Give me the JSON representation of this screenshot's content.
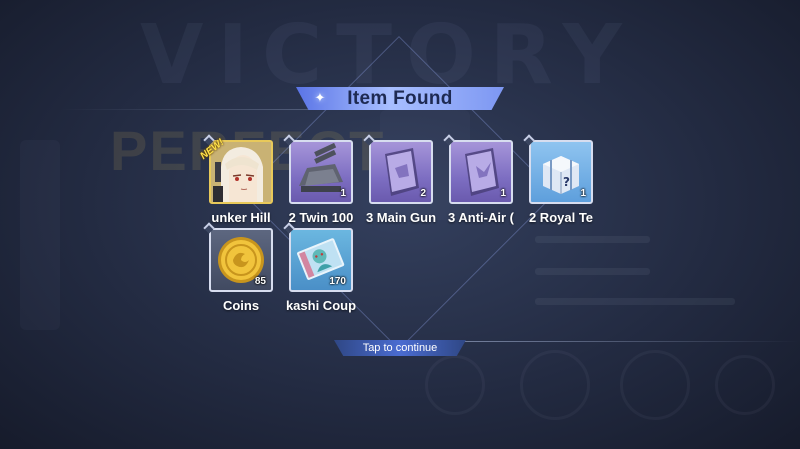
{
  "background": {
    "victory_text": "VICTORY",
    "rank_text": "PERFECT"
  },
  "header": {
    "title": "Item Found"
  },
  "items": [
    {
      "label": "unker Hill",
      "quantity": "",
      "new_badge": "NEW!",
      "icon": "character-portrait-icon"
    },
    {
      "label": "2 Twin 100",
      "quantity": "1",
      "icon": "twin-gun-turret-icon"
    },
    {
      "label": "3 Main Gun",
      "quantity": "2",
      "icon": "main-gun-blueprint-icon"
    },
    {
      "label": "3 Anti-Air (",
      "quantity": "1",
      "icon": "anti-air-blueprint-icon"
    },
    {
      "label": "2 Royal Te",
      "quantity": "1",
      "icon": "royal-tech-box-icon"
    },
    {
      "label": "Coins",
      "quantity": "85",
      "icon": "gold-coin-icon"
    },
    {
      "label": "kashi Coup",
      "quantity": "170",
      "icon": "akashi-coupon-icon"
    }
  ],
  "footer": {
    "continue_label": "Tap to continue"
  },
  "colors": {
    "header_gradient": "#8ba6f7",
    "header_text": "#1e2a52",
    "purple_frame": "#8f7fd0",
    "gold_frame": "#e8c95a",
    "tap_bar": "#3f5cb5"
  }
}
